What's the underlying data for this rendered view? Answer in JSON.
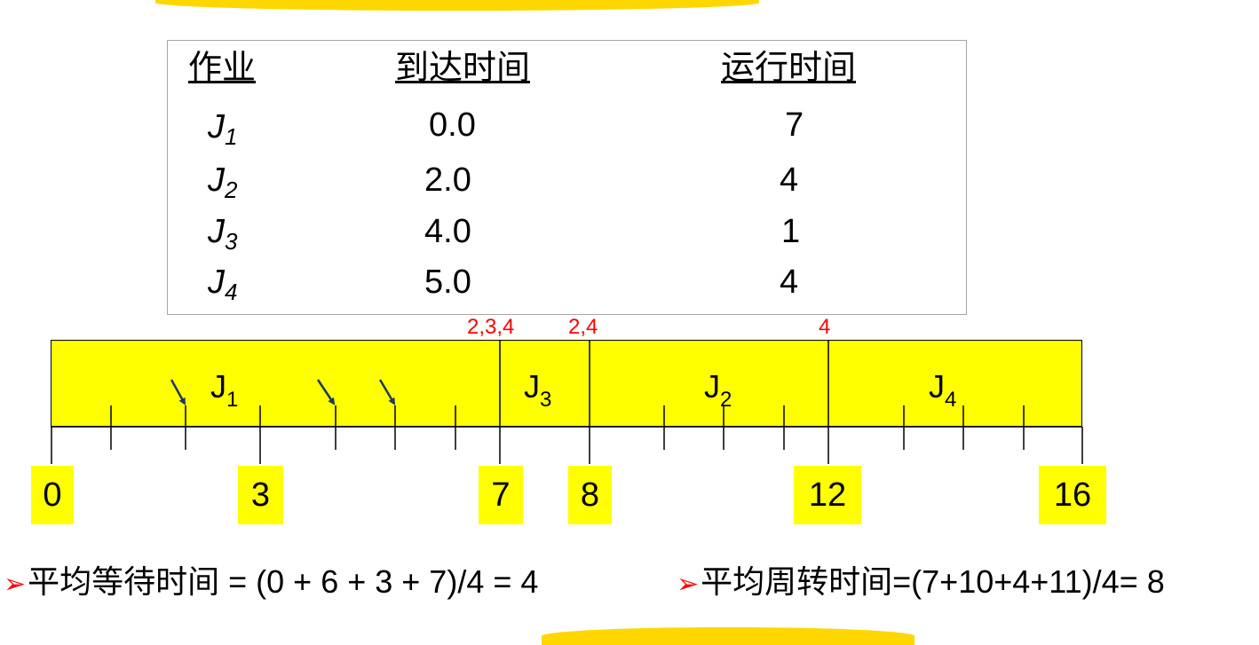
{
  "table": {
    "headers": [
      "作业",
      "到达时间",
      "运行时间"
    ],
    "rows": [
      {
        "job": "J",
        "sub": "1",
        "arrival": "0.0",
        "run": "7"
      },
      {
        "job": "J",
        "sub": "2",
        "arrival": "2.0",
        "run": "4"
      },
      {
        "job": "J",
        "sub": "3",
        "arrival": "4.0",
        "run": "1"
      },
      {
        "job": "J",
        "sub": "4",
        "arrival": "5.0",
        "run": "4"
      }
    ]
  },
  "gantt": {
    "blocks": [
      {
        "label": "J",
        "sub": "1",
        "start": 0,
        "end": 7
      },
      {
        "label": "J",
        "sub": "3",
        "start": 7,
        "end": 8
      },
      {
        "label": "J",
        "sub": "2",
        "start": 8,
        "end": 12
      },
      {
        "label": "J",
        "sub": "4",
        "start": 12,
        "end": 16
      }
    ],
    "queues": [
      {
        "time": 7,
        "text": "2,3,4"
      },
      {
        "time": 8,
        "text": "2,4"
      },
      {
        "time": 12,
        "text": "4"
      }
    ],
    "tick_labels": [
      "0",
      "3",
      "7",
      "8",
      "12",
      "16"
    ],
    "fill_color": "#ffff00",
    "queue_color": "#ff0000",
    "arrow_color": "#1f3864"
  },
  "summary": {
    "bullet": "➢",
    "avg_wait": "平均等待时间 = (0 + 6 + 3 + 7)/4 = 4",
    "avg_turnaround": "平均周转时间=(7+10+4+11)/4= 8"
  }
}
